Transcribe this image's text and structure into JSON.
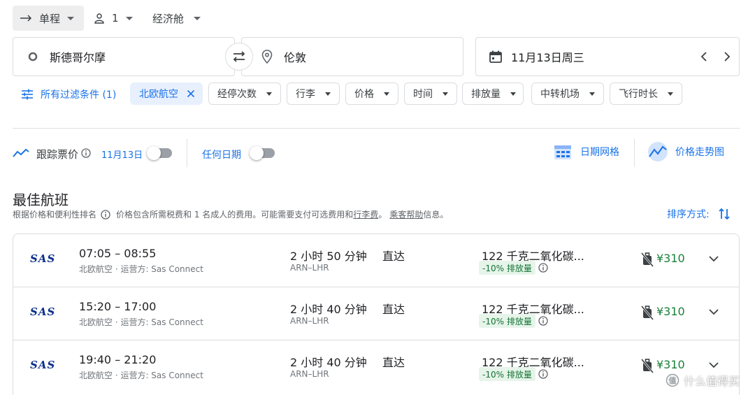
{
  "search": {
    "trip_type": "单程",
    "passengers": "1",
    "cabin": "经济舱",
    "origin": "斯德哥尔摩",
    "destination": "伦敦",
    "date": "11月13日周三"
  },
  "filters": {
    "all_filters": "所有过滤条件 (1)",
    "active_airline": "北欧航空",
    "chips": [
      "经停次数",
      "行李",
      "价格",
      "时间",
      "排放量",
      "中转机场",
      "飞行时长"
    ]
  },
  "tracking": {
    "track_label": "跟踪票价",
    "date_label": "11月13日",
    "any_date_label": "任何日期",
    "date_grid": "日期网格",
    "price_graph": "价格走势图"
  },
  "results": {
    "title": "最佳航班",
    "subtitle_rank": "根据价格和便利性排名",
    "subtitle_price": "价格包含所需税费和 1 名成人的费用。可能需要支付可选费用和",
    "baggage_fee": "行李费",
    "sep": "。",
    "passenger_help": "乘客帮助",
    "info_suffix": "信息。",
    "sort_label": "排序方式:"
  },
  "flights": [
    {
      "logo": "SAS",
      "times": "07:05 – 08:55",
      "airline": "北欧航空 · 运营方: Sas Connect",
      "duration": "2 小时 50 分钟",
      "route": "ARN–LHR",
      "stops": "直达",
      "emissions": "122 千克二氧化碳...",
      "emission_badge": "-10% 排放量",
      "price": "¥310"
    },
    {
      "logo": "SAS",
      "times": "15:20 – 17:00",
      "airline": "北欧航空 · 运营方: Sas Connect",
      "duration": "2 小时 40 分钟",
      "route": "ARN–LHR",
      "stops": "直达",
      "emissions": "122 千克二氧化碳...",
      "emission_badge": "-10% 排放量",
      "price": "¥310"
    },
    {
      "logo": "SAS",
      "times": "19:40 – 21:20",
      "airline": "北欧航空 · 运营方: Sas Connect",
      "duration": "2 小时 40 分钟",
      "route": "ARN–LHR",
      "stops": "直达",
      "emissions": "122 千克二氧化碳...",
      "emission_badge": "-10% 排放量",
      "price": "¥310"
    }
  ],
  "watermark": "什么值得买",
  "colors": {
    "accent": "#1a73e8",
    "price_green": "#188038",
    "badge_bg": "#e6f4ea"
  }
}
